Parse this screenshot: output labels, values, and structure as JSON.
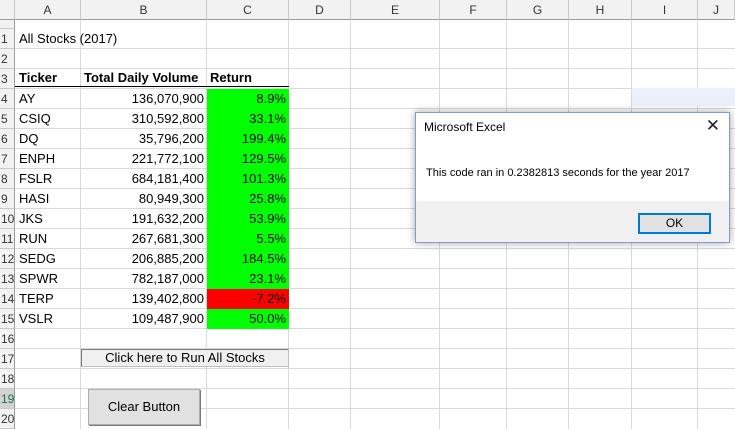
{
  "columns": [
    "A",
    "B",
    "C",
    "D",
    "E",
    "F",
    "G",
    "H",
    "I",
    "J"
  ],
  "rows": [
    "1",
    "2",
    "3",
    "4",
    "5",
    "6",
    "7",
    "8",
    "9",
    "10",
    "11",
    "12",
    "13",
    "14",
    "15",
    "16",
    "17",
    "18",
    "19",
    "20"
  ],
  "sheet": {
    "title": "All Stocks (2017)",
    "headers": {
      "ticker": "Ticker",
      "volume": "Total Daily Volume",
      "return": "Return"
    },
    "data": [
      {
        "ticker": "AY",
        "volume": "136,070,900",
        "return": "8.9%",
        "status": "positive"
      },
      {
        "ticker": "CSIQ",
        "volume": "310,592,800",
        "return": "33.1%",
        "status": "positive"
      },
      {
        "ticker": "DQ",
        "volume": "35,796,200",
        "return": "199.4%",
        "status": "positive"
      },
      {
        "ticker": "ENPH",
        "volume": "221,772,100",
        "return": "129.5%",
        "status": "positive"
      },
      {
        "ticker": "FSLR",
        "volume": "684,181,400",
        "return": "101.3%",
        "status": "positive"
      },
      {
        "ticker": "HASI",
        "volume": "80,949,300",
        "return": "25.8%",
        "status": "positive"
      },
      {
        "ticker": "JKS",
        "volume": "191,632,200",
        "return": "53.9%",
        "status": "positive"
      },
      {
        "ticker": "RUN",
        "volume": "267,681,300",
        "return": "5.5%",
        "status": "positive"
      },
      {
        "ticker": "SEDG",
        "volume": "206,885,200",
        "return": "184.5%",
        "status": "positive"
      },
      {
        "ticker": "SPWR",
        "volume": "782,187,000",
        "return": "23.1%",
        "status": "positive"
      },
      {
        "ticker": "TERP",
        "volume": "139,402,800",
        "return": "-7.2%",
        "status": "negative"
      },
      {
        "ticker": "VSLR",
        "volume": "109,487,900",
        "return": "50.0%",
        "status": "positive"
      }
    ],
    "colors": {
      "positive": "#00ff00",
      "negative": "#ff0000"
    }
  },
  "buttons": {
    "run_all": "Click here to Run All Stocks",
    "clear": "Clear Button"
  },
  "dialog": {
    "title": "Microsoft Excel",
    "message": "This code ran in 0.2382813 seconds for the year 2017",
    "ok_label": "OK",
    "close_icon": "close-icon"
  },
  "selected_row": "19"
}
